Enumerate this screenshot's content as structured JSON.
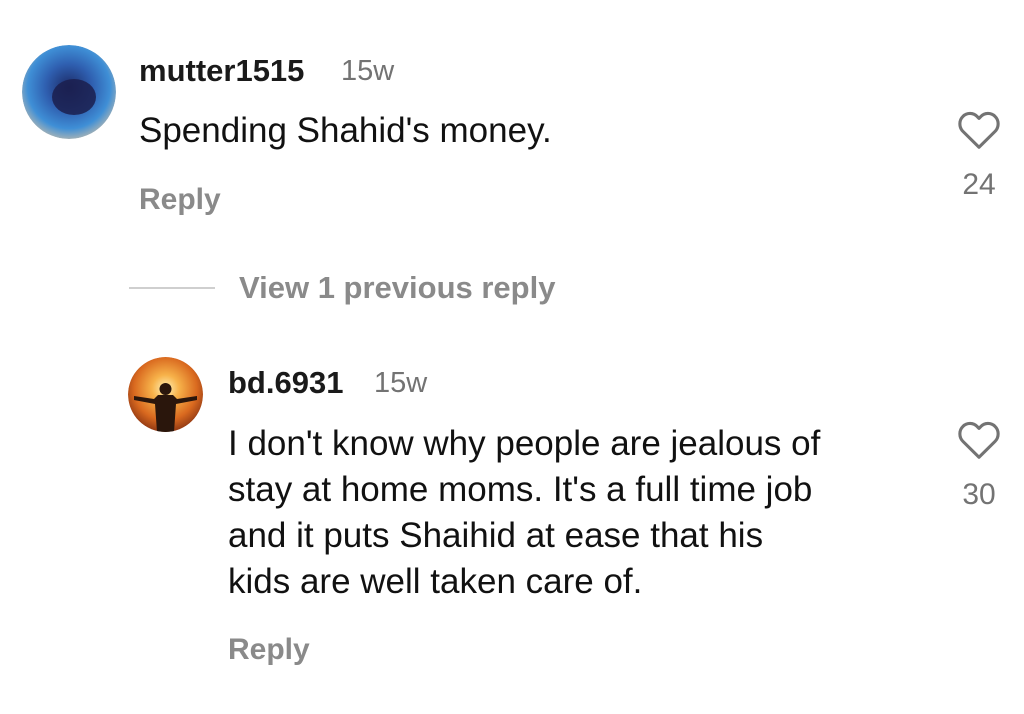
{
  "comments": [
    {
      "username": "mutter1515",
      "time": "15w",
      "text": "Spending Shahid's money.",
      "reply_label": "Reply",
      "likes": "24"
    }
  ],
  "view_previous": "View 1 previous reply",
  "replies": [
    {
      "username": "bd.6931",
      "time": "15w",
      "text_lines": [
        "I don't know why people are jealous of",
        "stay at home moms. It's a full time job",
        "and it puts Shaihid at ease that his",
        "kids are well taken care of."
      ],
      "reply_label": "Reply",
      "likes": "30"
    }
  ],
  "icons": {
    "like": "heart-outline-icon"
  },
  "colors": {
    "text": "#111111",
    "muted": "#737373",
    "action": "#8a8a8a"
  }
}
